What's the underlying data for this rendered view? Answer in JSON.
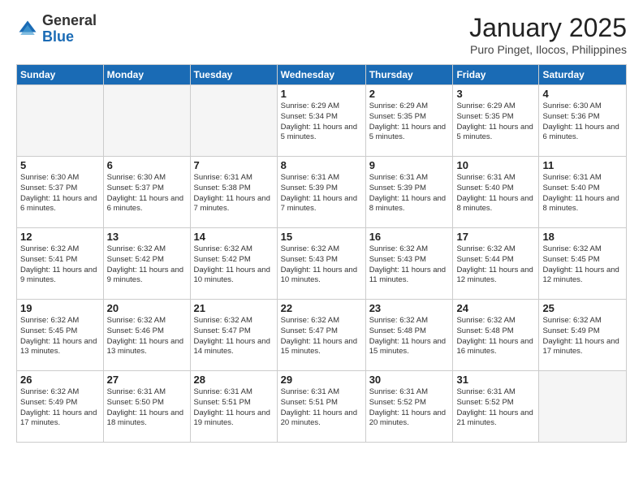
{
  "logo": {
    "general": "General",
    "blue": "Blue"
  },
  "header": {
    "title": "January 2025",
    "subtitle": "Puro Pinget, Ilocos, Philippines"
  },
  "weekdays": [
    "Sunday",
    "Monday",
    "Tuesday",
    "Wednesday",
    "Thursday",
    "Friday",
    "Saturday"
  ],
  "weeks": [
    [
      {
        "day": "",
        "empty": true
      },
      {
        "day": "",
        "empty": true
      },
      {
        "day": "",
        "empty": true
      },
      {
        "day": "1",
        "sunrise": "6:29 AM",
        "sunset": "5:34 PM",
        "daylight": "11 hours and 5 minutes."
      },
      {
        "day": "2",
        "sunrise": "6:29 AM",
        "sunset": "5:35 PM",
        "daylight": "11 hours and 5 minutes."
      },
      {
        "day": "3",
        "sunrise": "6:29 AM",
        "sunset": "5:35 PM",
        "daylight": "11 hours and 5 minutes."
      },
      {
        "day": "4",
        "sunrise": "6:30 AM",
        "sunset": "5:36 PM",
        "daylight": "11 hours and 6 minutes."
      }
    ],
    [
      {
        "day": "5",
        "sunrise": "6:30 AM",
        "sunset": "5:37 PM",
        "daylight": "11 hours and 6 minutes."
      },
      {
        "day": "6",
        "sunrise": "6:30 AM",
        "sunset": "5:37 PM",
        "daylight": "11 hours and 6 minutes."
      },
      {
        "day": "7",
        "sunrise": "6:31 AM",
        "sunset": "5:38 PM",
        "daylight": "11 hours and 7 minutes."
      },
      {
        "day": "8",
        "sunrise": "6:31 AM",
        "sunset": "5:39 PM",
        "daylight": "11 hours and 7 minutes."
      },
      {
        "day": "9",
        "sunrise": "6:31 AM",
        "sunset": "5:39 PM",
        "daylight": "11 hours and 8 minutes."
      },
      {
        "day": "10",
        "sunrise": "6:31 AM",
        "sunset": "5:40 PM",
        "daylight": "11 hours and 8 minutes."
      },
      {
        "day": "11",
        "sunrise": "6:31 AM",
        "sunset": "5:40 PM",
        "daylight": "11 hours and 8 minutes."
      }
    ],
    [
      {
        "day": "12",
        "sunrise": "6:32 AM",
        "sunset": "5:41 PM",
        "daylight": "11 hours and 9 minutes."
      },
      {
        "day": "13",
        "sunrise": "6:32 AM",
        "sunset": "5:42 PM",
        "daylight": "11 hours and 9 minutes."
      },
      {
        "day": "14",
        "sunrise": "6:32 AM",
        "sunset": "5:42 PM",
        "daylight": "11 hours and 10 minutes."
      },
      {
        "day": "15",
        "sunrise": "6:32 AM",
        "sunset": "5:43 PM",
        "daylight": "11 hours and 10 minutes."
      },
      {
        "day": "16",
        "sunrise": "6:32 AM",
        "sunset": "5:43 PM",
        "daylight": "11 hours and 11 minutes."
      },
      {
        "day": "17",
        "sunrise": "6:32 AM",
        "sunset": "5:44 PM",
        "daylight": "11 hours and 12 minutes."
      },
      {
        "day": "18",
        "sunrise": "6:32 AM",
        "sunset": "5:45 PM",
        "daylight": "11 hours and 12 minutes."
      }
    ],
    [
      {
        "day": "19",
        "sunrise": "6:32 AM",
        "sunset": "5:45 PM",
        "daylight": "11 hours and 13 minutes."
      },
      {
        "day": "20",
        "sunrise": "6:32 AM",
        "sunset": "5:46 PM",
        "daylight": "11 hours and 13 minutes."
      },
      {
        "day": "21",
        "sunrise": "6:32 AM",
        "sunset": "5:47 PM",
        "daylight": "11 hours and 14 minutes."
      },
      {
        "day": "22",
        "sunrise": "6:32 AM",
        "sunset": "5:47 PM",
        "daylight": "11 hours and 15 minutes."
      },
      {
        "day": "23",
        "sunrise": "6:32 AM",
        "sunset": "5:48 PM",
        "daylight": "11 hours and 15 minutes."
      },
      {
        "day": "24",
        "sunrise": "6:32 AM",
        "sunset": "5:48 PM",
        "daylight": "11 hours and 16 minutes."
      },
      {
        "day": "25",
        "sunrise": "6:32 AM",
        "sunset": "5:49 PM",
        "daylight": "11 hours and 17 minutes."
      }
    ],
    [
      {
        "day": "26",
        "sunrise": "6:32 AM",
        "sunset": "5:49 PM",
        "daylight": "11 hours and 17 minutes."
      },
      {
        "day": "27",
        "sunrise": "6:31 AM",
        "sunset": "5:50 PM",
        "daylight": "11 hours and 18 minutes."
      },
      {
        "day": "28",
        "sunrise": "6:31 AM",
        "sunset": "5:51 PM",
        "daylight": "11 hours and 19 minutes."
      },
      {
        "day": "29",
        "sunrise": "6:31 AM",
        "sunset": "5:51 PM",
        "daylight": "11 hours and 20 minutes."
      },
      {
        "day": "30",
        "sunrise": "6:31 AM",
        "sunset": "5:52 PM",
        "daylight": "11 hours and 20 minutes."
      },
      {
        "day": "31",
        "sunrise": "6:31 AM",
        "sunset": "5:52 PM",
        "daylight": "11 hours and 21 minutes."
      },
      {
        "day": "",
        "empty": true
      }
    ]
  ],
  "labels": {
    "sunrise": "Sunrise:",
    "sunset": "Sunset:",
    "daylight": "Daylight:"
  }
}
